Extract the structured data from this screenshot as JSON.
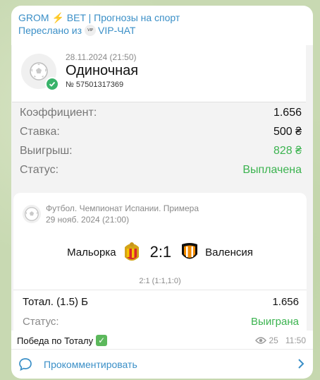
{
  "header": {
    "channel": "GROM ⚡ BET | Прогнозы на спорт",
    "forwarded_prefix": "Переслано из",
    "forwarded_badge": "VIP",
    "forwarded_from": "VIP-ЧАТ"
  },
  "ticket": {
    "date": "28.11.2024 (21:50)",
    "type": "Одиночная",
    "number": "№ 57501317369"
  },
  "rows": [
    {
      "label": "Коэффициент:",
      "value": "1.656"
    },
    {
      "label": "Ставка:",
      "value": "500 ₴"
    },
    {
      "label": "Выигрыш:",
      "value": "828 ₴"
    },
    {
      "label": "Статус:",
      "value": "Выплачена"
    }
  ],
  "event": {
    "league": "Футбол. Чемпионат Испании. Примера",
    "date": "29 нояб. 2024 (21:00)",
    "home": "Мальорка",
    "score": "2:1",
    "away": "Валенсия",
    "sub_score": "2:1 (1:1,1:0)",
    "market": "Тотал. (1.5) Б",
    "odd": "1.656",
    "status_label": "Статус:",
    "status_value": "Выиграна"
  },
  "caption": "Победа по Тоталу",
  "meta": {
    "views": "25",
    "time": "11:50"
  },
  "comment_label": "Прокомментировать",
  "colors": {
    "accent": "#3a8fc7",
    "win": "#3bb34f"
  }
}
